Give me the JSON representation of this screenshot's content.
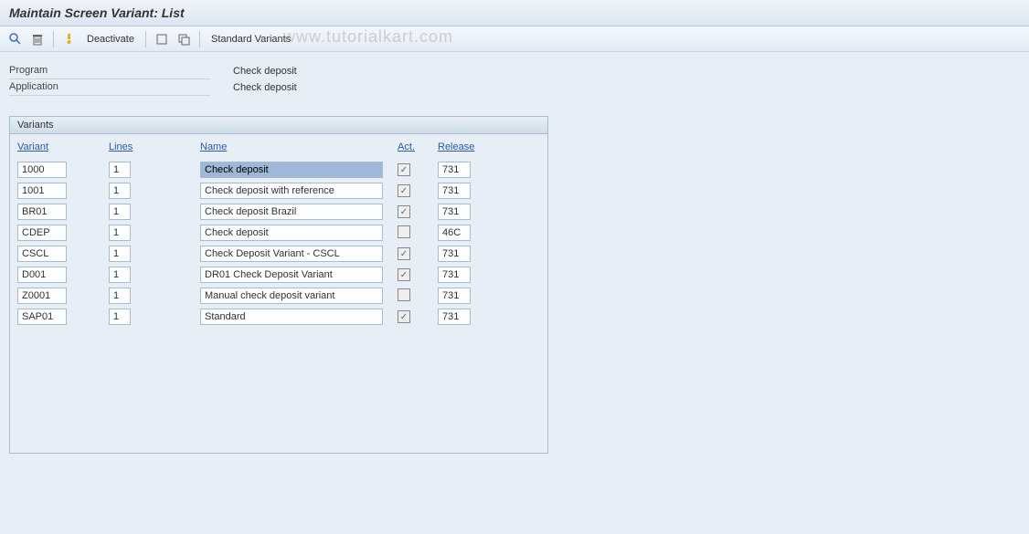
{
  "title": "Maintain Screen Variant: List",
  "watermark": "www.tutorialkart.com",
  "toolbar": {
    "deactivate_label": "Deactivate",
    "standard_variants_label": "Standard Variants"
  },
  "info": {
    "program_label": "Program",
    "program_value": "Check deposit",
    "application_label": "Application",
    "application_value": "Check deposit"
  },
  "panel": {
    "title": "Variants",
    "headers": {
      "variant": "Variant",
      "lines": "Lines",
      "name": "Name",
      "act": "Act.",
      "release": "Release"
    },
    "rows": [
      {
        "variant": "1000",
        "lines": "1",
        "name": "Check deposit",
        "act": true,
        "release": "731",
        "selected": true
      },
      {
        "variant": "1001",
        "lines": "1",
        "name": "Check deposit with reference",
        "act": true,
        "release": "731",
        "selected": false
      },
      {
        "variant": "BR01",
        "lines": "1",
        "name": "Check deposit Brazil",
        "act": true,
        "release": "731",
        "selected": false
      },
      {
        "variant": "CDEP",
        "lines": "1",
        "name": "Check deposit",
        "act": false,
        "release": "46C",
        "selected": false
      },
      {
        "variant": "CSCL",
        "lines": "1",
        "name": "Check Deposit Variant - CSCL",
        "act": true,
        "release": "731",
        "selected": false
      },
      {
        "variant": "D001",
        "lines": "1",
        "name": "DR01 Check Deposit Variant",
        "act": true,
        "release": "731",
        "selected": false
      },
      {
        "variant": "Z0001",
        "lines": "1",
        "name": "Manual check deposit variant",
        "act": false,
        "release": "731",
        "selected": false
      },
      {
        "variant": "SAP01",
        "lines": "1",
        "name": "Standard",
        "act": true,
        "release": "731",
        "selected": false
      }
    ]
  }
}
